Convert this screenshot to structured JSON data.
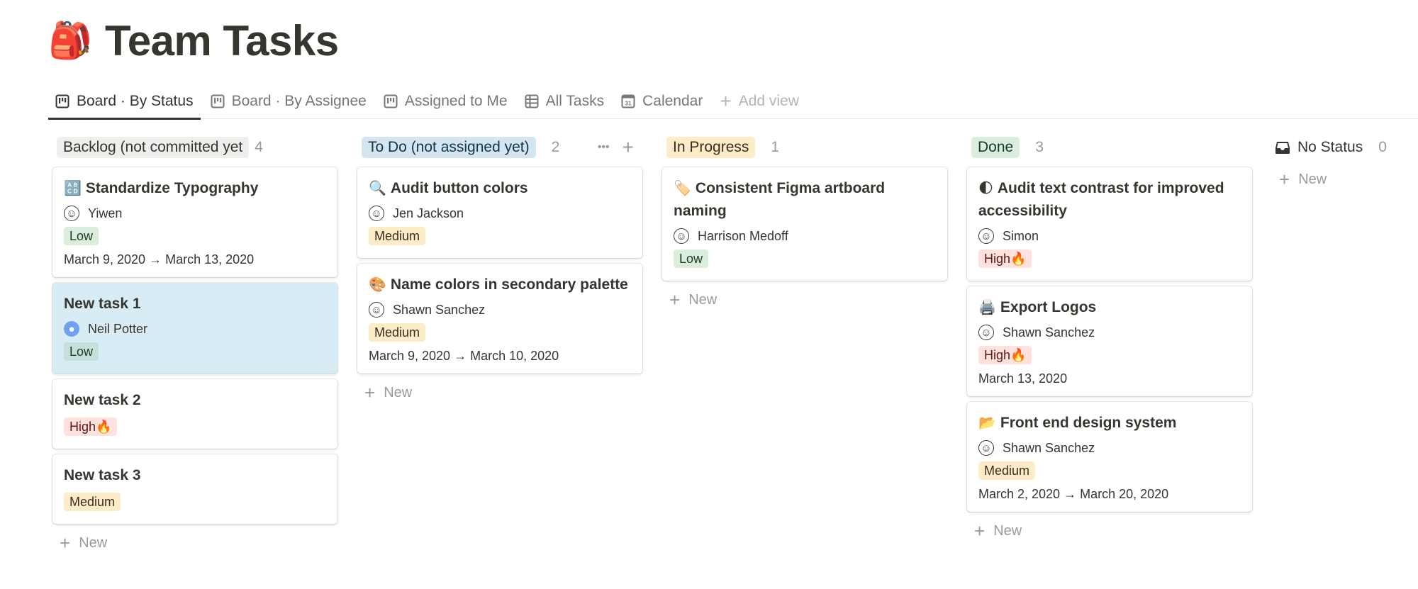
{
  "page": {
    "icon": "🎒",
    "icon_name": "backpack-icon",
    "title": "Team Tasks"
  },
  "tabs": [
    {
      "label": "Board · By Status",
      "icon": "board-icon",
      "active": true
    },
    {
      "label": "Board · By Assignee",
      "icon": "board-icon",
      "active": false
    },
    {
      "label": "Assigned to Me",
      "icon": "board-icon",
      "active": false
    },
    {
      "label": "All Tasks",
      "icon": "table-icon",
      "active": false
    },
    {
      "label": "Calendar",
      "icon": "calendar-icon",
      "active": false
    },
    {
      "label": "Add view",
      "icon": "plus-icon",
      "active": false
    }
  ],
  "colors": {
    "backlog_bg": "#eeeeed",
    "todo_bg": "#d3e5ef",
    "inprogress_bg": "#fdecc8",
    "done_bg": "#dbeddb",
    "low_bg": "#dbeddb",
    "low_fg": "#1c3829",
    "medium_bg": "#fdecc8",
    "medium_fg": "#402c1b",
    "high_bg": "#ffe2dd",
    "high_fg": "#5d1715",
    "selected_card_bg": "#d8ecf5"
  },
  "new_label": "New",
  "columns": [
    {
      "title": "Backlog (not committed yet",
      "count": "4",
      "cards": [
        {
          "emoji": "🔠",
          "title": "Standardize Typography",
          "assignee": "Yiwen",
          "avatar": "👩",
          "priority": "Low",
          "date": "March 9, 2020 → March 13, 2020"
        },
        {
          "emoji": "",
          "title": "New task 1",
          "assignee": "Neil Potter",
          "avatar": "generic",
          "priority": "Low",
          "date": "",
          "selected": true
        },
        {
          "emoji": "",
          "title": "New task 2",
          "assignee": "",
          "avatar": "",
          "priority": "High🔥",
          "date": ""
        },
        {
          "emoji": "",
          "title": "New task 3",
          "assignee": "",
          "avatar": "",
          "priority": "Medium",
          "date": ""
        }
      ]
    },
    {
      "title": "To Do (not assigned yet)",
      "count": "2",
      "actions": {
        "more": "•••",
        "add": "+"
      },
      "cards": [
        {
          "emoji": "🔍",
          "title": "Audit button colors",
          "assignee": "Jen Jackson",
          "avatar": "👩",
          "priority": "Medium",
          "date": ""
        },
        {
          "emoji": "🎨",
          "title": "Name colors in secondary palette",
          "assignee": "Shawn Sanchez",
          "avatar": "🧑",
          "priority": "Medium",
          "date": "March 9, 2020 → March 10, 2020"
        }
      ]
    },
    {
      "title": "In Progress",
      "count": "1",
      "cards": [
        {
          "emoji": "🏷️",
          "title": "Consistent Figma artboard naming",
          "assignee": "Harrison Medoff",
          "avatar": "🧑",
          "priority": "Low",
          "date": ""
        }
      ]
    },
    {
      "title": "Done",
      "count": "3",
      "cards": [
        {
          "emoji": "🌓",
          "title": "Audit text contrast for improved accessibility",
          "assignee": "Simon",
          "avatar": "🧑",
          "priority": "High🔥",
          "date": ""
        },
        {
          "emoji": "🖨️",
          "title": "Export Logos",
          "assignee": "Shawn Sanchez",
          "avatar": "🧑",
          "priority": "High🔥",
          "date": "March 13, 2020"
        },
        {
          "emoji": "📂",
          "title": "Front end design system",
          "assignee": "Shawn Sanchez",
          "avatar": "🧑",
          "priority": "Medium",
          "date": "March 2, 2020 → March 20, 2020"
        }
      ]
    }
  ],
  "no_status": {
    "title": "No Status",
    "count": "0",
    "icon": "inbox-icon"
  }
}
